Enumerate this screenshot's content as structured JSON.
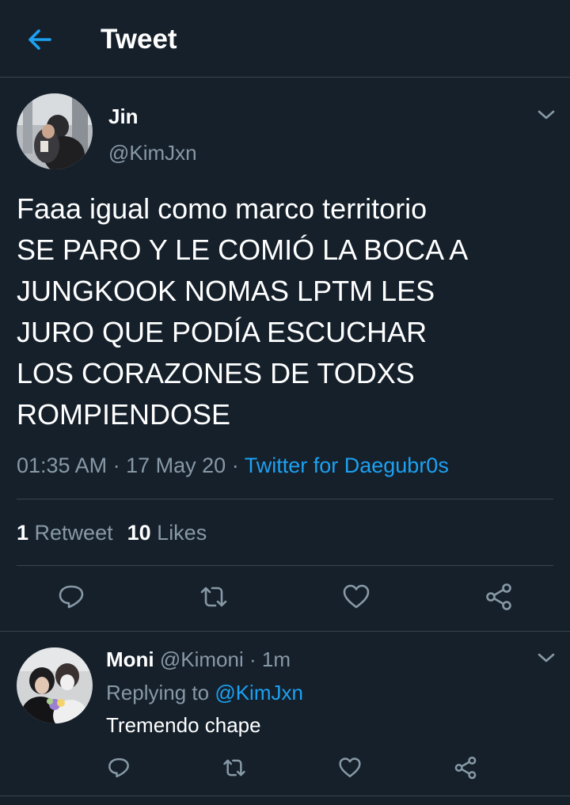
{
  "header": {
    "title": "Tweet",
    "back_icon": "arrow-left-icon"
  },
  "tweet": {
    "author_name": "Jin",
    "author_handle": "@KimJxn",
    "text_lines": [
      "Faaa igual como marco territorio",
      "SE PARO Y LE COMIÓ LA BOCA A",
      "JUNGKOOK NOMAS LPTM LES",
      "JURO QUE PODÍA ESCUCHAR",
      "LOS CORAZONES DE TODXS",
      "ROMPIENDOSE"
    ],
    "time": "01:35 AM",
    "date": "17 May 20",
    "separator": "·",
    "source": "Twitter for Daegubr0s",
    "retweets_count": "1",
    "retweets_label": "Retweet",
    "likes_count": "10",
    "likes_label": "Likes"
  },
  "reply": {
    "name": "Moni",
    "handle": "@Kimoni",
    "separator": "·",
    "time": "1m",
    "replying_prefix": "Replying to",
    "replying_to": "@KimJxn",
    "text": "Tremendo chape"
  },
  "colors": {
    "background": "#15202b",
    "accent": "#1da1f2",
    "secondary_text": "#8899a6",
    "divider": "#38444d"
  },
  "icons": [
    "arrow-left-icon",
    "chevron-down-icon",
    "reply-icon",
    "retweet-icon",
    "like-icon",
    "share-icon"
  ]
}
